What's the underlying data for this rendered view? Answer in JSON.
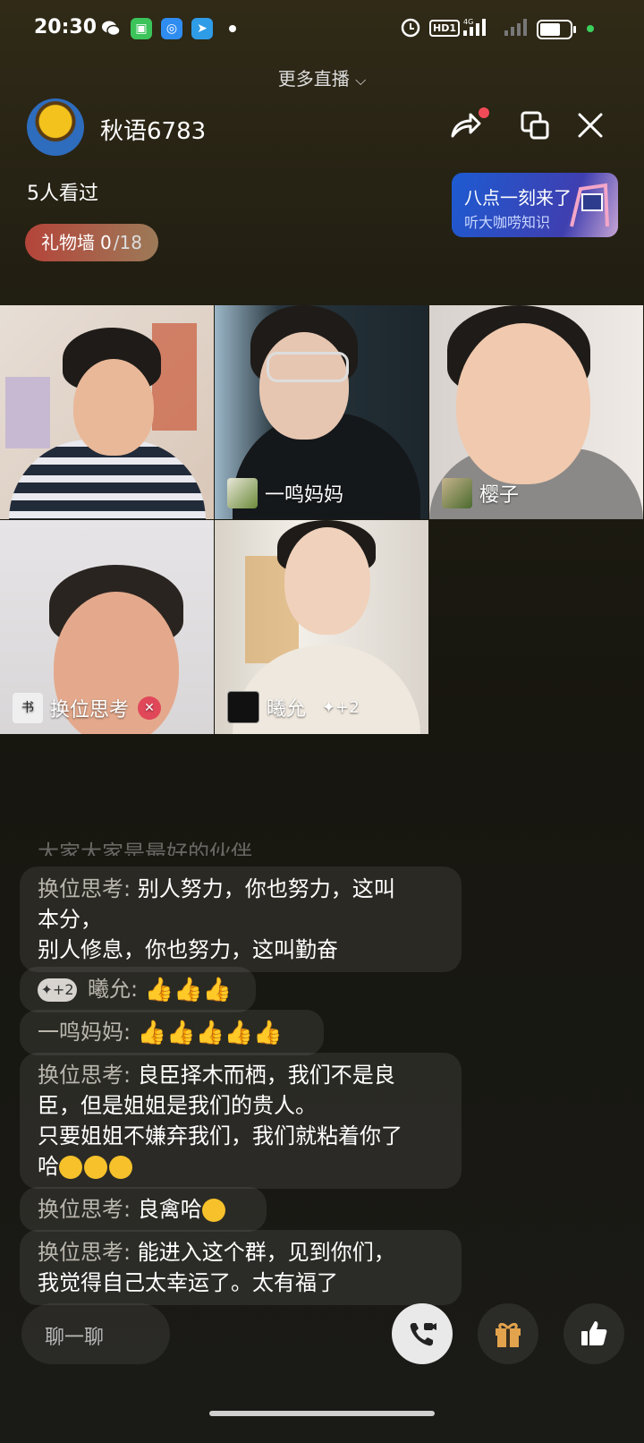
{
  "status_bar": {
    "time": "20:30",
    "hd_label": "HD1",
    "network": "4G"
  },
  "header": {
    "more_live": "更多直播",
    "host_name": "秋语6783",
    "viewers": "5人看过",
    "gift_wall": {
      "label": "礼物墙",
      "count": "0",
      "total": "/18"
    },
    "promo": {
      "title": "八点一刻来了",
      "subtitle": "听大咖唠知识"
    }
  },
  "video_tiles": [
    {
      "name": ""
    },
    {
      "name": "一鸣妈妈"
    },
    {
      "name": "樱子"
    },
    {
      "name": "换位思考",
      "mic_muted": true
    },
    {
      "name": "曦允",
      "badge": "+2"
    }
  ],
  "chat_partial_top": "大家大家是最好的伙伴",
  "chat": [
    {
      "user": "换位思考:",
      "lines": [
        "别人努力，你也努力，这叫",
        "本分，",
        "别人修息，你也努力，这叫勤奋"
      ]
    },
    {
      "badge": "+2",
      "user": "曦允:",
      "emoji": "thumbs-up-light",
      "emoji_count": 3
    },
    {
      "user": "一鸣妈妈:",
      "emoji": "thumbs-up-yellow",
      "emoji_count": 5
    },
    {
      "user": "换位思考:",
      "lines": [
        "良臣择木而栖，我们不是良",
        "臣，但是姐姐是我们的贵人。",
        "只要姐姐不嫌弃我们，我们就粘着你了",
        "哈"
      ],
      "trailing_emoji_count": 3
    },
    {
      "user": "换位思考:",
      "text": "良禽哈",
      "trailing_emoji_count": 1
    },
    {
      "user": "换位思考:",
      "lines": [
        "能进入这个群，见到你们，",
        "我觉得自己太幸运了。太有福了"
      ]
    }
  ],
  "bottom_bar": {
    "chat_placeholder": "聊一聊"
  },
  "icons": [
    "wechat-icon",
    "app-store-icon",
    "qq-browser-icon",
    "telegram-icon",
    "alarm-icon",
    "share-icon",
    "window-icon",
    "close-icon",
    "phone-video-icon",
    "gift-icon",
    "like-icon"
  ]
}
